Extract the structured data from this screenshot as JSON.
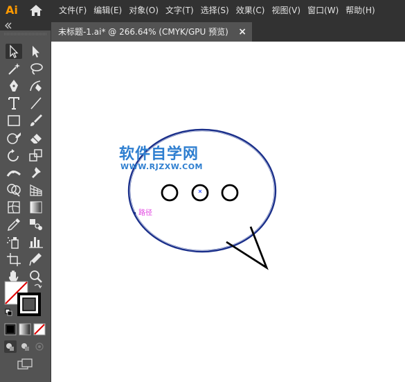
{
  "app": {
    "logo": "Ai"
  },
  "menu": {
    "items": [
      {
        "label": "文件(F)"
      },
      {
        "label": "编辑(E)"
      },
      {
        "label": "对象(O)"
      },
      {
        "label": "文字(T)"
      },
      {
        "label": "选择(S)"
      },
      {
        "label": "效果(C)"
      },
      {
        "label": "视图(V)"
      },
      {
        "label": "窗口(W)"
      },
      {
        "label": "帮助(H)"
      }
    ]
  },
  "tab": {
    "title": "未标题-1.ai* @ 266.64% (CMYK/GPU 预览)",
    "close": "×"
  },
  "canvas": {
    "watermark_title": "软件自学网",
    "watermark_url": "WWW.RJZXW.COM",
    "path_label": "路径"
  },
  "colors": {
    "accent_orange": "#ff9a00",
    "selection_blue": "#1a2f8a",
    "watermark_blue": "#2f7fd0",
    "hint_magenta": "#e040e0"
  },
  "tools": {
    "icons": [
      "selection-tool-icon",
      "direct-selection-tool-icon",
      "magic-wand-tool-icon",
      "lasso-tool-icon",
      "pen-tool-icon",
      "curvature-tool-icon",
      "type-tool-icon",
      "line-segment-tool-icon",
      "rectangle-tool-icon",
      "paintbrush-tool-icon",
      "shaper-tool-icon",
      "eraser-tool-icon",
      "rotate-tool-icon",
      "scale-tool-icon",
      "width-tool-icon",
      "puppet-warp-tool-icon",
      "shape-builder-tool-icon",
      "perspective-grid-tool-icon",
      "mesh-tool-icon",
      "gradient-tool-icon",
      "eyedropper-tool-icon",
      "blend-tool-icon",
      "symbol-sprayer-tool-icon",
      "column-graph-tool-icon",
      "artboard-tool-icon",
      "slice-tool-icon",
      "hand-tool-icon",
      "zoom-tool-icon"
    ]
  }
}
